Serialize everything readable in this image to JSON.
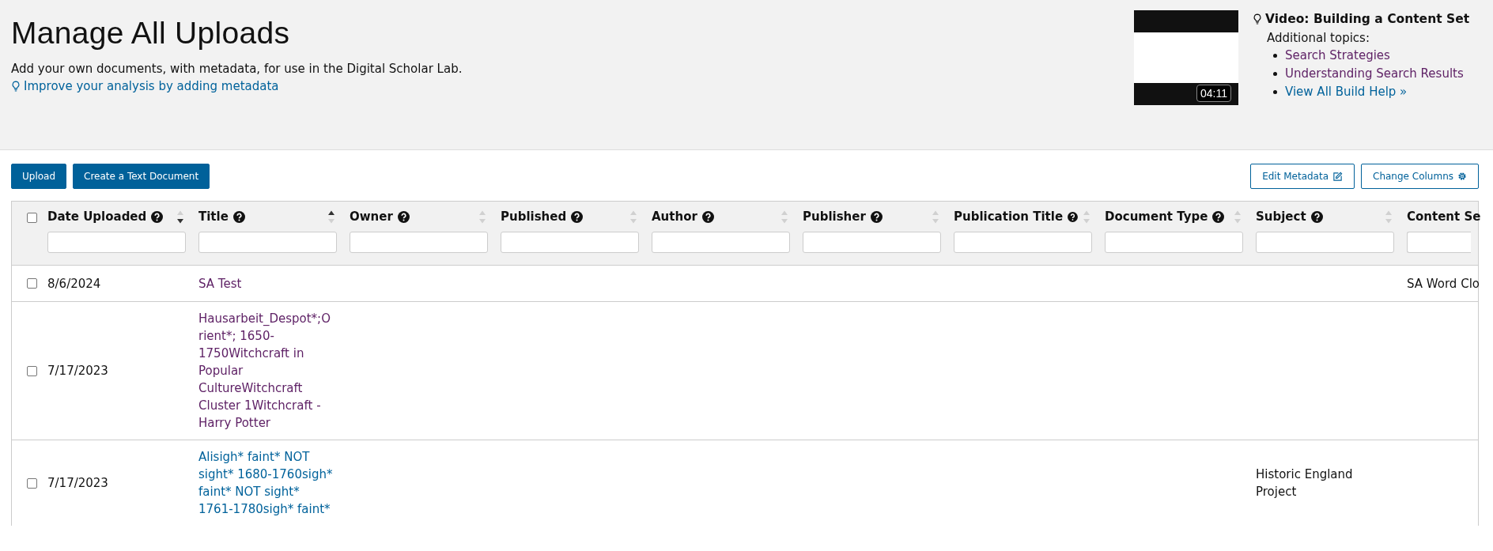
{
  "page": {
    "title": "Manage All Uploads",
    "description": "Add your own documents, with metadata, for use in the Digital Scholar Lab.",
    "tip_link": "Improve your analysis by adding metadata"
  },
  "help": {
    "video_duration": "04:11",
    "video_title": "Video: Building a Content Set",
    "topics_label": "Additional topics:",
    "topics": [
      {
        "label": "Search Strategies",
        "visited": true
      },
      {
        "label": "Understanding Search Results",
        "visited": true
      },
      {
        "label": "View All Build Help »",
        "visited": false
      }
    ]
  },
  "toolbar": {
    "left_buttons": [
      "Upload",
      "Create a Text Document"
    ],
    "right_buttons": [
      "Edit Metadata",
      "Change Columns"
    ]
  },
  "table": {
    "select_all_checked": false,
    "columns": [
      {
        "label": "Date Uploaded",
        "sorted_ascending": false,
        "sorted_descending": true
      },
      {
        "label": "Title",
        "sorted_ascending": true,
        "sorted_descending": false
      },
      {
        "label": "Owner",
        "sorted_ascending": false,
        "sorted_descending": false
      },
      {
        "label": "Published",
        "sorted_ascending": false,
        "sorted_descending": false
      },
      {
        "label": "Author",
        "sorted_ascending": false,
        "sorted_descending": false
      },
      {
        "label": "Publisher",
        "sorted_ascending": false,
        "sorted_descending": false
      },
      {
        "label": "Publication Title",
        "sorted_ascending": false,
        "sorted_descending": false
      },
      {
        "label": "Document Type",
        "sorted_ascending": false,
        "sorted_descending": false
      },
      {
        "label": "Subject",
        "sorted_ascending": false,
        "sorted_descending": false
      },
      {
        "label": "Content Se"
      }
    ],
    "rows": [
      {
        "checked": false,
        "date_uploaded": "8/6/2024",
        "title": "SA Test",
        "title_visited": true,
        "content_set": "SA Word Clo"
      },
      {
        "checked": false,
        "date_uploaded": "7/17/2023",
        "title": "Hausarbeit_Despot*;Orient*; 1650-1750Witchcraft in Popular CultureWitchcraft Cluster 1Witchcraft - Harry Potter",
        "title_visited": true
      },
      {
        "checked": false,
        "date_uploaded": "7/17/2023",
        "title": "Alisigh* faint* NOT sight* 1680-1760sigh* faint* NOT sight* 1761-1780sigh* faint*",
        "title_visited": false,
        "subject": "Historic England Project"
      }
    ]
  }
}
